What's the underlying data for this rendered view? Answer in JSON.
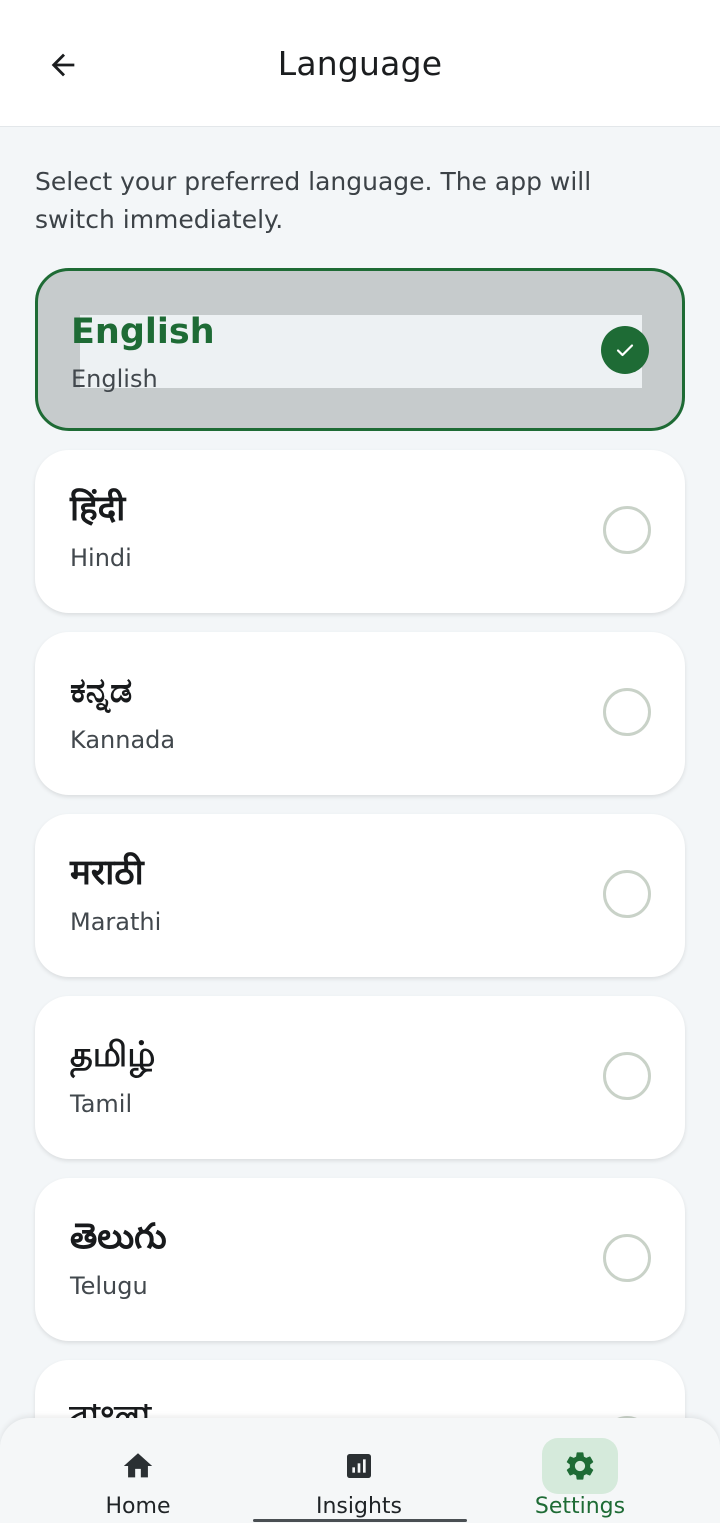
{
  "header": {
    "title": "Language"
  },
  "intro_text": "Select your preferred language. The app will switch immediately.",
  "languages": [
    {
      "native": "English",
      "english": "English",
      "selected": true
    },
    {
      "native": "हिंदी",
      "english": "Hindi",
      "selected": false
    },
    {
      "native": "ಕನ್ನಡ",
      "english": "Kannada",
      "selected": false
    },
    {
      "native": "मराठी",
      "english": "Marathi",
      "selected": false
    },
    {
      "native": "தமிழ்",
      "english": "Tamil",
      "selected": false
    },
    {
      "native": "తెలుగు",
      "english": "Telugu",
      "selected": false
    },
    {
      "native": "বাংলা",
      "english": "",
      "selected": false
    }
  ],
  "bottom_nav": {
    "items": [
      {
        "label": "Home",
        "icon": "home-icon",
        "active": false
      },
      {
        "label": "Insights",
        "icon": "insights-icon",
        "active": false
      },
      {
        "label": "Settings",
        "icon": "gear-icon",
        "active": true
      }
    ]
  },
  "colors": {
    "accent": "#1e6b35",
    "selected_card": "#c6cbcc",
    "active_nav_bg": "#d5eadb"
  }
}
